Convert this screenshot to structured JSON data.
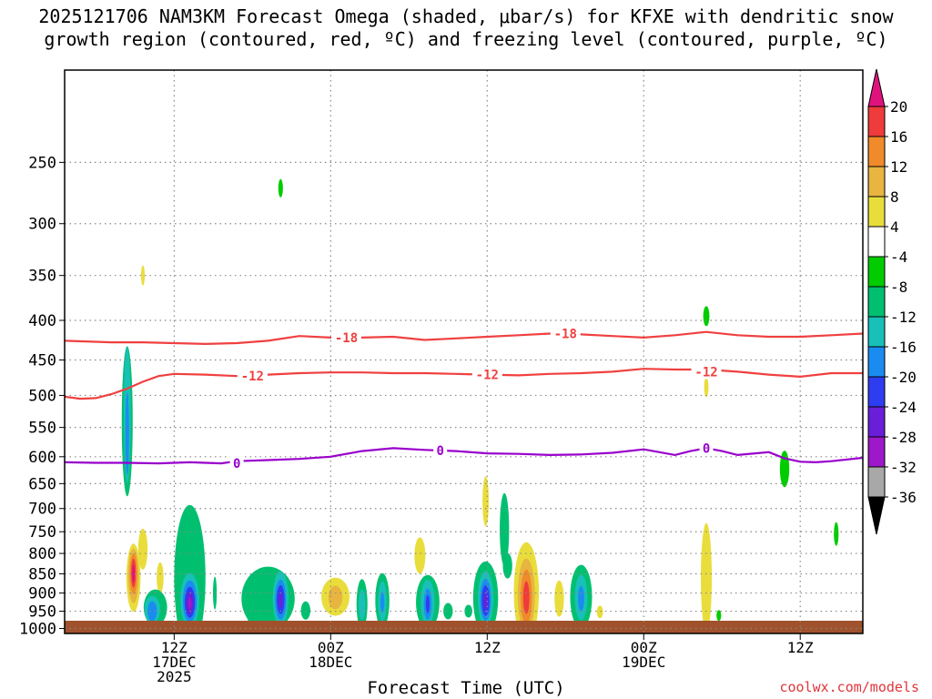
{
  "header": {
    "title_line1": "2025121706 NAM3KM Forecast Omega (shaded, μbar/s) for KFXE with dendritic snow",
    "title_line2": "growth region (contoured, red, ºC) and freezing level (contoured, purple, ºC)"
  },
  "footer": {
    "xaxis_title": "Forecast Time (UTC)",
    "watermark": "coolwx.com/models"
  },
  "colors": {
    "ground": "#a0522d",
    "dgz_contour": "#f04040",
    "freezing_contour": "#9900cc",
    "grid": "#888888"
  },
  "chart_data": {
    "type": "heatmap",
    "x_unit": "hours since 2025121706",
    "x_range": [
      -1,
      50
    ],
    "y_unit": "hPa",
    "y_scale": "log",
    "y_range": [
      1015,
      190
    ],
    "y_ticks": [
      250,
      300,
      350,
      400,
      450,
      500,
      550,
      600,
      650,
      700,
      750,
      800,
      850,
      900,
      950,
      1000
    ],
    "x_ticks": [
      {
        "x": 6,
        "lines": [
          "12Z",
          "17DEC",
          "2025"
        ]
      },
      {
        "x": 16,
        "lines": [
          "00Z",
          "18DEC"
        ]
      },
      {
        "x": 26,
        "lines": [
          "12Z"
        ]
      },
      {
        "x": 36,
        "lines": [
          "00Z",
          "19DEC"
        ]
      },
      {
        "x": 46,
        "lines": [
          "12Z"
        ]
      }
    ],
    "colorbar": {
      "labels": [
        "20",
        "16",
        "12",
        "8",
        "4",
        "-4",
        "-8",
        "-12",
        "-16",
        "-20",
        "-24",
        "-28",
        "-32",
        "-36"
      ],
      "colors": [
        "#e0137e",
        "#ef3b3b",
        "#f08a2a",
        "#e8b540",
        "#e9dd3c",
        "#ffffff",
        "#00cc00",
        "#00c070",
        "#18c0b8",
        "#1a8cf0",
        "#2f3df0",
        "#6a1ed8",
        "#9c18c8",
        "#a8a8a8",
        "#000000"
      ]
    },
    "contours": [
      {
        "label": "-18",
        "color": "#f04040",
        "x": [
          -1,
          2,
          4,
          6,
          8,
          10,
          12,
          14,
          16,
          18,
          20,
          22,
          24,
          26,
          28,
          30,
          32,
          34,
          36,
          38,
          40,
          42,
          44,
          46,
          48,
          50
        ],
        "y": [
          425,
          427,
          427,
          428,
          429,
          428,
          425,
          419,
          421,
          421,
          420,
          424,
          422,
          420,
          418,
          416,
          417,
          419,
          421,
          418,
          414,
          418,
          420,
          420,
          418,
          416
        ],
        "label_at": [
          [
            17,
            421
          ],
          [
            31,
            416
          ]
        ]
      },
      {
        "label": "-12",
        "color": "#f04040",
        "x": [
          -1,
          0,
          1,
          2,
          3,
          4,
          5,
          6,
          8,
          10,
          12,
          14,
          16,
          18,
          20,
          22,
          24,
          26,
          28,
          30,
          32,
          34,
          36,
          38,
          40,
          42,
          44,
          46,
          48,
          50
        ],
        "y": [
          502,
          505,
          504,
          498,
          490,
          480,
          472,
          469,
          470,
          472,
          470,
          468,
          467,
          467,
          468,
          468,
          469,
          470,
          471,
          469,
          468,
          466,
          462,
          463,
          463,
          466,
          470,
          473,
          468,
          468
        ],
        "label_at": [
          [
            11,
            472
          ],
          [
            26,
            470
          ],
          [
            40,
            466
          ]
        ]
      },
      {
        "label": "0",
        "color": "#9900cc",
        "x": [
          -1,
          1,
          3,
          5,
          7,
          9,
          10,
          12,
          14,
          16,
          18,
          20,
          22,
          24,
          26,
          28,
          30,
          32,
          34,
          36,
          38,
          39,
          40,
          41,
          42,
          44,
          45,
          46,
          47,
          48,
          50
        ],
        "y": [
          610,
          611,
          611,
          612,
          610,
          612,
          608,
          606,
          604,
          600,
          590,
          585,
          588,
          590,
          594,
          595,
          597,
          596,
          593,
          587,
          597,
          590,
          585,
          590,
          597,
          592,
          603,
          609,
          610,
          608,
          602
        ],
        "label_at": [
          [
            10,
            612
          ],
          [
            23,
            589
          ],
          [
            40,
            585
          ]
        ]
      }
    ],
    "omega_cells": [
      {
        "x": 3.0,
        "y": 540,
        "w": 0.35,
        "h": 165,
        "v": -8
      },
      {
        "x": 3.0,
        "y": 530,
        "w": 0.22,
        "h": 150,
        "v": -12
      },
      {
        "x": 3.0,
        "y": 560,
        "w": 0.12,
        "h": 90,
        "v": -16
      },
      {
        "x": 4.0,
        "y": 350,
        "w": 0.12,
        "h": 22,
        "v": 4
      },
      {
        "x": 4.0,
        "y": 790,
        "w": 0.3,
        "h": 45,
        "v": 4
      },
      {
        "x": 3.4,
        "y": 860,
        "w": 0.45,
        "h": 75,
        "v": 4
      },
      {
        "x": 3.4,
        "y": 855,
        "w": 0.34,
        "h": 60,
        "v": 8
      },
      {
        "x": 3.4,
        "y": 850,
        "w": 0.24,
        "h": 45,
        "v": 12
      },
      {
        "x": 3.4,
        "y": 848,
        "w": 0.15,
        "h": 32,
        "v": 16
      },
      {
        "x": 3.4,
        "y": 850,
        "w": 0.08,
        "h": 20,
        "v": 20
      },
      {
        "x": 5.1,
        "y": 860,
        "w": 0.22,
        "h": 34,
        "v": 4
      },
      {
        "x": 4.8,
        "y": 940,
        "w": 0.75,
        "h": 40,
        "v": -8
      },
      {
        "x": 4.6,
        "y": 945,
        "w": 0.5,
        "h": 30,
        "v": -12
      },
      {
        "x": 4.6,
        "y": 950,
        "w": 0.3,
        "h": 22,
        "v": -16
      },
      {
        "x": 6.3,
        "y": 890,
        "w": 0.25,
        "h": 30,
        "v": 4
      },
      {
        "x": 7.0,
        "y": 860,
        "w": 1.0,
        "h": 160,
        "v": -8
      },
      {
        "x": 7.0,
        "y": 920,
        "w": 0.6,
        "h": 60,
        "v": -12
      },
      {
        "x": 7.0,
        "y": 922,
        "w": 0.45,
        "h": 46,
        "v": -16
      },
      {
        "x": 7.0,
        "y": 925,
        "w": 0.33,
        "h": 34,
        "v": -20
      },
      {
        "x": 7.0,
        "y": 927,
        "w": 0.22,
        "h": 24,
        "v": -24
      },
      {
        "x": 7.0,
        "y": 928,
        "w": 0.13,
        "h": 14,
        "v": -28
      },
      {
        "x": 8.6,
        "y": 900,
        "w": 0.12,
        "h": 36,
        "v": -8
      },
      {
        "x": 12.8,
        "y": 270,
        "w": 0.15,
        "h": 20,
        "v": -4
      },
      {
        "x": 12.0,
        "y": 915,
        "w": 1.7,
        "h": 70,
        "v": -8
      },
      {
        "x": 12.8,
        "y": 915,
        "w": 0.5,
        "h": 60,
        "v": -12
      },
      {
        "x": 12.8,
        "y": 918,
        "w": 0.36,
        "h": 44,
        "v": -16
      },
      {
        "x": 12.8,
        "y": 918,
        "w": 0.25,
        "h": 32,
        "v": -20
      },
      {
        "x": 12.8,
        "y": 920,
        "w": 0.12,
        "h": 18,
        "v": -24
      },
      {
        "x": 10.9,
        "y": 945,
        "w": 0.3,
        "h": 30,
        "v": -8
      },
      {
        "x": 14.4,
        "y": 948,
        "w": 0.3,
        "h": 20,
        "v": -8
      },
      {
        "x": 16.3,
        "y": 910,
        "w": 0.9,
        "h": 42,
        "v": 4
      },
      {
        "x": 16.3,
        "y": 912,
        "w": 0.45,
        "h": 26,
        "v": 8
      },
      {
        "x": 18.0,
        "y": 930,
        "w": 0.35,
        "h": 55,
        "v": -8
      },
      {
        "x": 18.0,
        "y": 932,
        "w": 0.22,
        "h": 34,
        "v": -12
      },
      {
        "x": 19.3,
        "y": 920,
        "w": 0.45,
        "h": 60,
        "v": -8
      },
      {
        "x": 19.3,
        "y": 922,
        "w": 0.28,
        "h": 44,
        "v": -12
      },
      {
        "x": 19.3,
        "y": 925,
        "w": 0.13,
        "h": 22,
        "v": -16
      },
      {
        "x": 22.2,
        "y": 925,
        "w": 0.75,
        "h": 60,
        "v": -8
      },
      {
        "x": 22.2,
        "y": 925,
        "w": 0.45,
        "h": 50,
        "v": -12
      },
      {
        "x": 22.2,
        "y": 930,
        "w": 0.25,
        "h": 34,
        "v": -16
      },
      {
        "x": 22.2,
        "y": 930,
        "w": 0.12,
        "h": 20,
        "v": -20
      },
      {
        "x": 21.7,
        "y": 805,
        "w": 0.35,
        "h": 40,
        "v": 4
      },
      {
        "x": 23.5,
        "y": 950,
        "w": 0.3,
        "h": 18,
        "v": -8
      },
      {
        "x": 24.8,
        "y": 950,
        "w": 0.25,
        "h": 14,
        "v": -8
      },
      {
        "x": 25.9,
        "y": 913,
        "w": 0.8,
        "h": 80,
        "v": -8
      },
      {
        "x": 25.9,
        "y": 915,
        "w": 0.5,
        "h": 60,
        "v": -12
      },
      {
        "x": 25.9,
        "y": 918,
        "w": 0.35,
        "h": 46,
        "v": -16
      },
      {
        "x": 25.9,
        "y": 920,
        "w": 0.25,
        "h": 34,
        "v": -20
      },
      {
        "x": 25.9,
        "y": 922,
        "w": 0.12,
        "h": 18,
        "v": -24
      },
      {
        "x": 25.9,
        "y": 685,
        "w": 0.2,
        "h": 55,
        "v": 4
      },
      {
        "x": 27.1,
        "y": 745,
        "w": 0.3,
        "h": 80,
        "v": -8
      },
      {
        "x": 27.3,
        "y": 830,
        "w": 0.3,
        "h": 28,
        "v": -8
      },
      {
        "x": 28.5,
        "y": 898,
        "w": 0.8,
        "h": 110,
        "v": 4
      },
      {
        "x": 28.5,
        "y": 905,
        "w": 0.55,
        "h": 80,
        "v": 8
      },
      {
        "x": 28.5,
        "y": 910,
        "w": 0.36,
        "h": 60,
        "v": 12
      },
      {
        "x": 28.5,
        "y": 912,
        "w": 0.2,
        "h": 36,
        "v": 16
      },
      {
        "x": 30.6,
        "y": 915,
        "w": 0.3,
        "h": 40,
        "v": 4
      },
      {
        "x": 32.0,
        "y": 910,
        "w": 0.7,
        "h": 70,
        "v": -8
      },
      {
        "x": 32.0,
        "y": 912,
        "w": 0.4,
        "h": 50,
        "v": -12
      },
      {
        "x": 32.0,
        "y": 915,
        "w": 0.2,
        "h": 28,
        "v": -16
      },
      {
        "x": 33.2,
        "y": 952,
        "w": 0.2,
        "h": 14,
        "v": 4
      },
      {
        "x": 40.0,
        "y": 395,
        "w": 0.2,
        "h": 22,
        "v": -4
      },
      {
        "x": 40.0,
        "y": 488,
        "w": 0.14,
        "h": 22,
        "v": 4
      },
      {
        "x": 40.0,
        "y": 860,
        "w": 0.35,
        "h": 120,
        "v": 4
      },
      {
        "x": 40.8,
        "y": 962,
        "w": 0.15,
        "h": 12,
        "v": -4
      },
      {
        "x": 45.0,
        "y": 622,
        "w": 0.3,
        "h": 40,
        "v": -4
      },
      {
        "x": 48.3,
        "y": 755,
        "w": 0.15,
        "h": 26,
        "v": -4
      }
    ]
  }
}
